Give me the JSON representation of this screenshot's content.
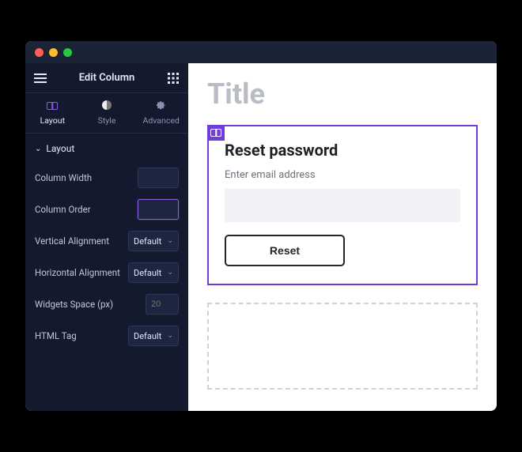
{
  "panel": {
    "title": "Edit Column",
    "tabs": [
      {
        "key": "layout",
        "label": "Layout"
      },
      {
        "key": "style",
        "label": "Style"
      },
      {
        "key": "advanced",
        "label": "Advanced"
      }
    ],
    "section": {
      "label": "Layout"
    },
    "fields": {
      "column_width": {
        "label": "Column Width",
        "value": ""
      },
      "column_order": {
        "label": "Column Order",
        "value": ""
      },
      "vertical_alignment": {
        "label": "Vertical Alignment",
        "value": "Default"
      },
      "horizontal_alignment": {
        "label": "Horizontal Alignment",
        "value": "Default"
      },
      "widgets_space": {
        "label": "Widgets Space (px)",
        "placeholder": "20"
      },
      "html_tag": {
        "label": "HTML Tag",
        "value": "Default"
      }
    }
  },
  "canvas": {
    "page_title": "Title",
    "form": {
      "heading": "Reset password",
      "label": "Enter email address",
      "button": "Reset"
    }
  },
  "colors": {
    "accent": "#6f3ddc",
    "panel_bg": "#141a2e"
  }
}
